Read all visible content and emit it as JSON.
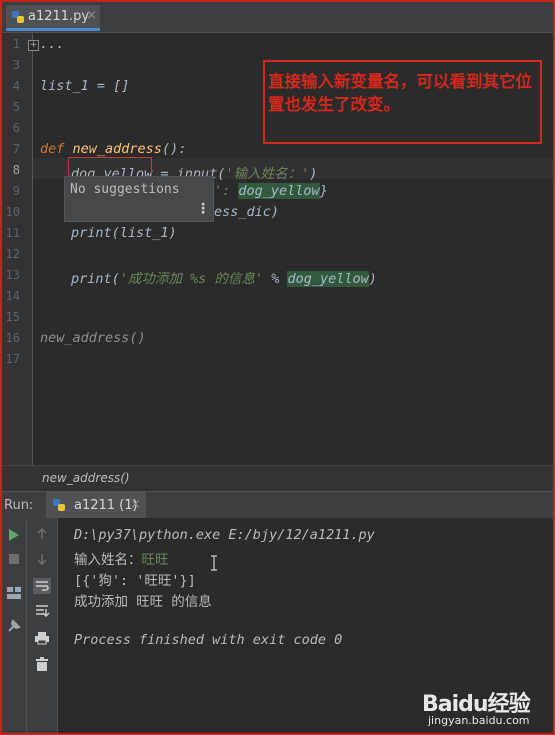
{
  "editor_tab": {
    "filename": "a1211.py",
    "close": "×"
  },
  "line_numbers": [
    "1",
    "3",
    "4",
    "5",
    "6",
    "7",
    "8",
    "9",
    "10",
    "11",
    "12",
    "13",
    "14",
    "15",
    "16",
    "17"
  ],
  "code": {
    "l1": "...",
    "l4_var": "list_1",
    "l4_rest": " = []",
    "l7_def": "def",
    "l7_name": "new_address",
    "l7_rest": "():",
    "l8_var": "dog_yellow",
    "l8_mid": " = input(",
    "l8_str": "'输入姓名：'",
    "l8_end": ")",
    "l9_str": "':",
    "l9_var": "dog_yellow",
    "l9_end": "}",
    "l10": "ess_dic)",
    "l11": "print(list_1)",
    "l13_a": "print(",
    "l13_str": "'成功添加 %s 的信息'",
    "l13_b": " % ",
    "l13_var": "dog_yellow",
    "l13_c": ")",
    "l16": "new_address()"
  },
  "annotation": "直接输入新变量名，可以看到其它位置也发生了改变。",
  "suggestion_popup": {
    "text": "No suggestions",
    "menu": "⋮"
  },
  "breadcrumb": "new_address()",
  "run_panel": {
    "label": "Run:",
    "tab_name": "a1211 (1)",
    "close": "×"
  },
  "console": {
    "line1": "D:\\py37\\python.exe E:/bjy/12/a1211.py",
    "line2_prompt": "输入姓名：",
    "line2_input": "旺旺",
    "line3": "[{'狗': '旺旺'}]",
    "line4": "成功添加 旺旺 的信息",
    "line5": "Process finished with exit code 0"
  },
  "watermark": {
    "logo": "Baidu经验",
    "url": "jingyan.baidu.com"
  },
  "colors": {
    "frame": "#c8241c",
    "annotation": "#d3281c",
    "keyword": "#cc7832",
    "function": "#ffc66d",
    "string": "#6a8759"
  }
}
